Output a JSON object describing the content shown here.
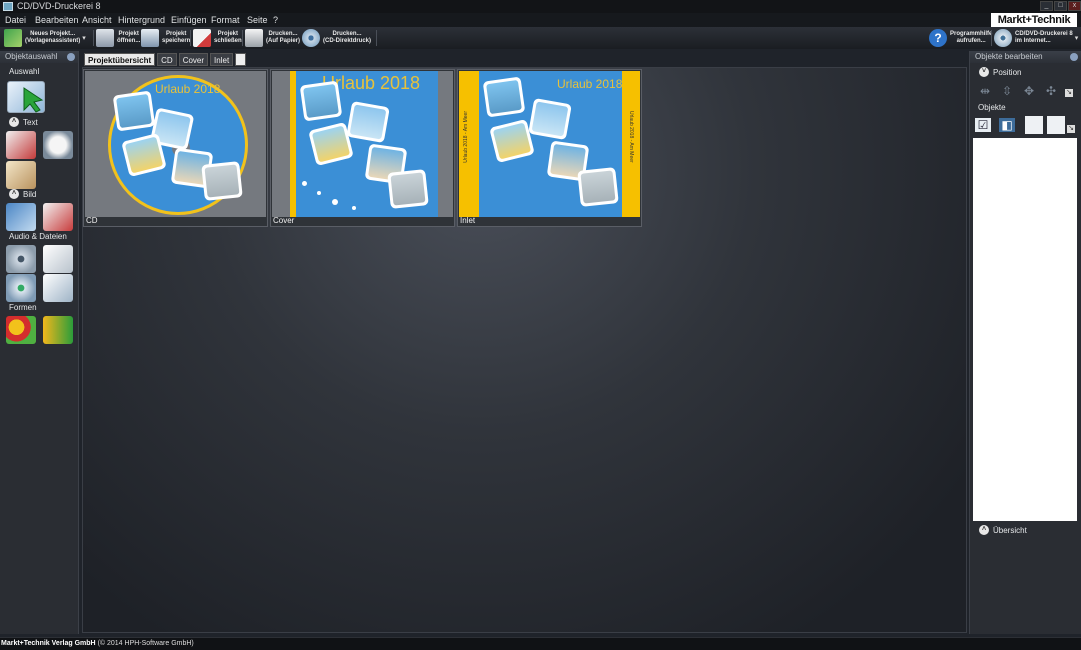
{
  "window": {
    "title": "CD/DVD-Druckerei 8"
  },
  "brand": "Markt+Technik",
  "menu": [
    "Datei",
    "Bearbeiten",
    "Ansicht",
    "Hintergrund",
    "Einfügen",
    "Format",
    "Seite",
    "?"
  ],
  "toolbar": {
    "new_project": {
      "line1": "Neues Projekt...",
      "line2": "(Vorlagenassistent)"
    },
    "open_project": {
      "line1": "Projekt",
      "line2": "öffnen..."
    },
    "save_project": {
      "line1": "Projekt",
      "line2": "speichern"
    },
    "close_project": {
      "line1": "Projekt",
      "line2": "schließen"
    },
    "print_paper": {
      "line1": "Drucken...",
      "line2": "(Auf Papier)"
    },
    "print_cd": {
      "line1": "Drucken...",
      "line2": "(CD-Direktdruck)"
    },
    "help": {
      "line1": "Programmhilfe",
      "line2": "aufrufen..."
    },
    "internet": {
      "line1": "CD/DVD-Druckerei 8",
      "line2": "im Internet..."
    }
  },
  "left_panel": {
    "title": "Objektauswahl",
    "sections": {
      "selection": "Auswahl",
      "text": "Text",
      "image": "Bild",
      "audio": "Audio & Dateien",
      "shapes": "Formen"
    }
  },
  "tabs": [
    {
      "label": "Projektübersicht",
      "active": true
    },
    {
      "label": "CD",
      "active": false
    },
    {
      "label": "Cover",
      "active": false
    },
    {
      "label": "Inlet",
      "active": false
    }
  ],
  "thumbnails": [
    {
      "caption": "CD",
      "heading": "Urlaub 2018"
    },
    {
      "caption": "Cover",
      "heading": "Urlaub 2018"
    },
    {
      "caption": "Inlet",
      "heading": "Urlaub 2018",
      "spine_text": "Urlaub 2018 - Am Meer"
    }
  ],
  "right_panel": {
    "title": "Objekte bearbeiten",
    "position": "Position",
    "objects": "Objekte",
    "overview": "Übersicht"
  },
  "statusbar": {
    "company": "Markt+Technik Verlag GmbH",
    "copyright": "(© 2014 HPH-Software GmbH)"
  },
  "colors": {
    "accent_yellow": "#f6c000",
    "sea_blue": "#3b8fd6",
    "heading_yellow": "#e8c23a"
  }
}
